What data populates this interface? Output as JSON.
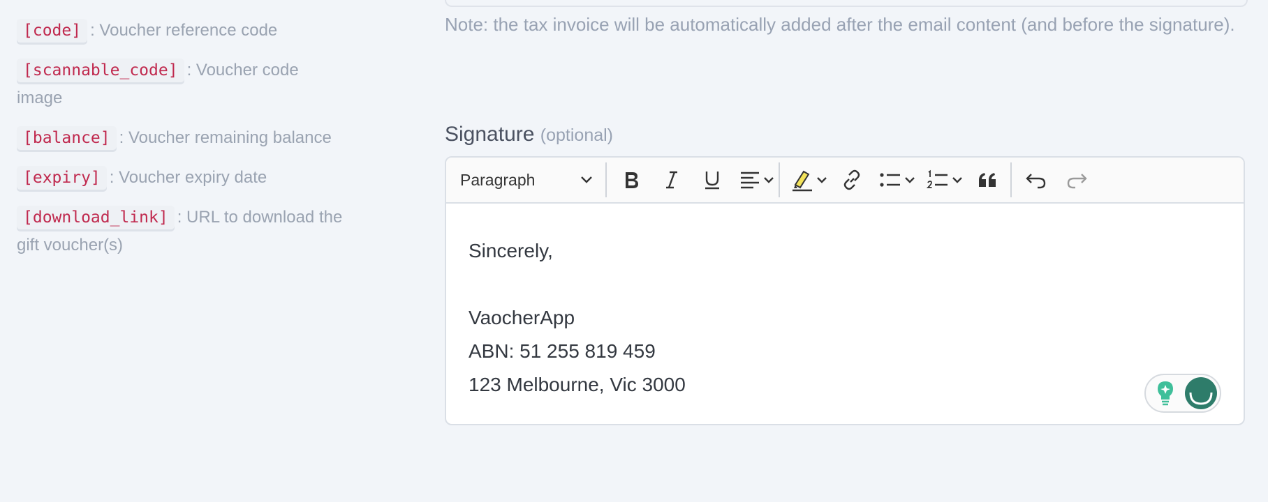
{
  "placeholders": [
    {
      "code": "[code]",
      "description": ": Voucher reference code"
    },
    {
      "code": "[scannable_code]",
      "description": ": Voucher code image"
    },
    {
      "code": "[balance]",
      "description": ": Voucher remaining balance"
    },
    {
      "code": "[expiry]",
      "description": ": Voucher expiry date"
    },
    {
      "code": "[download_link]",
      "description": ": URL to download the gift voucher(s)"
    }
  ],
  "note": "Note: the tax invoice will be automatically added after the email content (and before the signature).",
  "signature": {
    "label": "Signature",
    "optional": "(optional)",
    "toolbar": {
      "paragraph": "Paragraph"
    },
    "content": {
      "line1": "Sincerely,",
      "line2": "VaocherApp",
      "line3": "ABN: 51 255 819 459",
      "line4": "123 Melbourne, Vic 3000"
    }
  },
  "colors": {
    "background": "#f2f5f9",
    "code_text": "#c0294e",
    "muted_text": "#9aa3b1",
    "grammarly": "#2e7c6a"
  }
}
